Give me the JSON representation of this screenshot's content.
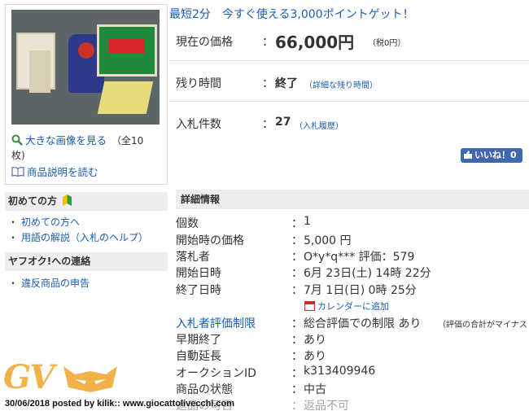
{
  "left": {
    "view_large_image": "大きな画像を見る",
    "image_count_a": "（全10",
    "image_count_b": "枚)",
    "read_description": "商品説明を読む",
    "first_time": {
      "heading": "初めての方",
      "items": [
        "初めての方へ",
        "用語の解説（入札のヘルプ）"
      ]
    },
    "contact": {
      "heading": "ヤフオク!への連絡",
      "items": [
        "違反商品の申告"
      ]
    }
  },
  "promo": "最短2分　今すぐ使える3,000ポイントゲット！",
  "summary": {
    "price_label": "現在の価格",
    "price_value": "66,000円",
    "price_tax": "（税0円）",
    "time_label": "残り時間",
    "time_value": "終了",
    "time_link": "（詳細な残り時間）",
    "bids_label": "入札件数",
    "bids_value": "27",
    "bids_link": "（入札履歴）",
    "colon": "："
  },
  "like_button": "いいね！0",
  "details": {
    "heading": "詳細情報",
    "rows": [
      {
        "label": "個数",
        "value": "1"
      },
      {
        "label": "開始時の価格",
        "value": "5,000 円"
      },
      {
        "label": "落札者",
        "value": "O*y*q*** 評価：579"
      },
      {
        "label": "開始日時",
        "value": "6月 23日(土) 14時 22分"
      },
      {
        "label": "終了日時",
        "value": "7月 1日(日) 0時 25分"
      },
      {
        "label": "入札者評価制限",
        "value": "総合評価での制限 あり"
      },
      {
        "label": "早期終了",
        "value": "あり"
      },
      {
        "label": "自動延長",
        "value": "あり"
      },
      {
        "label": "オークションID",
        "value": "k313409946"
      },
      {
        "label": "商品の状態",
        "value": "中古"
      },
      {
        "label": "返品の可否",
        "value": "返品不可"
      }
    ],
    "calendar_link": "カレンダーに追加",
    "restriction_note": "（評価の合計がマイナス",
    "colon": "："
  },
  "watermark": {
    "logo": "GV",
    "credit": "30/06/2018 posted by kilik:: www.giocattolivecchi.com"
  }
}
